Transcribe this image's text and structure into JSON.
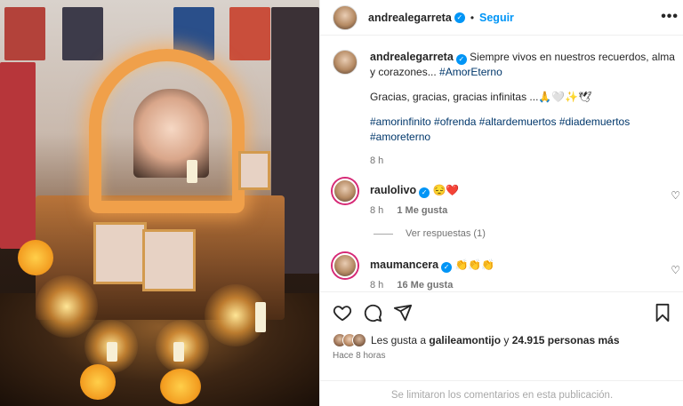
{
  "header": {
    "username": "andrealegarreta",
    "separator": "•",
    "follow_label": "Seguir",
    "more_icon": "more-icon"
  },
  "caption": {
    "username": "andrealegarreta",
    "text": "Siempre vivos en nuestros recuerdos, alma y corazones...",
    "hashtag_inline": "#AmorEterno",
    "line2": "Gracias, gracias, gracias infinitas ...🙏🤍✨🕊",
    "hashtags": [
      "#amorinfinito",
      "#ofrenda",
      "#altardemuertos",
      "#diademuertos",
      "#amoreterno"
    ],
    "time": "8 h"
  },
  "comments": [
    {
      "username": "raulolivo",
      "text": "😔❤️",
      "time": "8 h",
      "likes": "1 Me gusta"
    },
    {
      "username": "maumancera",
      "text": "👏👏👏",
      "time": "8 h",
      "likes": "16 Me gusta"
    }
  ],
  "replies_label": "Ver respuestas (1)",
  "likes": {
    "prefix": "Les gusta a ",
    "user": "galileamontijo",
    "middle": " y ",
    "count": "24.915 personas más"
  },
  "posted_ago": "Hace 8 horas",
  "comments_disabled": "Se limitaron los comentarios en esta publicación.",
  "colors": {
    "accent": "#0095f6",
    "hashtag": "#00376b",
    "muted": "#737373",
    "heart": "#ed4956"
  }
}
